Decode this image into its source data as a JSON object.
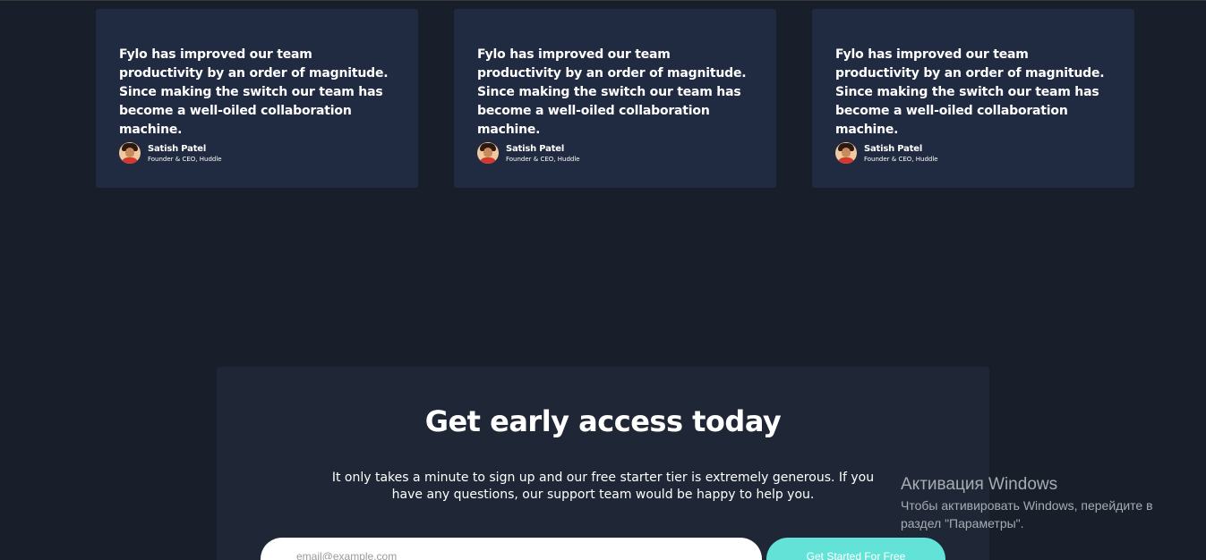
{
  "testimonials": [
    {
      "quote": "Fylo has improved our team productivity by an order of magnitude. Since making the switch our team has become a well-oiled collaboration machine.",
      "name": "Satish Patel",
      "role": "Founder & CEO, Huddle"
    },
    {
      "quote": "Fylo has improved our team productivity by an order of magnitude. Since making the switch our team has become a well-oiled collaboration machine.",
      "name": "Satish Patel",
      "role": "Founder & CEO, Huddle"
    },
    {
      "quote": "Fylo has improved our team productivity by an order of magnitude. Since making the switch our team has become a well-oiled collaboration machine.",
      "name": "Satish Patel",
      "role": "Founder & CEO, Huddle"
    }
  ],
  "access": {
    "title": "Get early access today",
    "description": "It only takes a minute to sign up and our free starter tier is extremely generous. If you have any questions, our support team would be happy to help you.",
    "email_placeholder": "email@example.com",
    "button_label": "Get Started For Free"
  },
  "windows_activation": {
    "title": "Активация Windows",
    "message": "Чтобы активировать Windows, перейдите в раздел \"Параметры\"."
  },
  "colors": {
    "background": "#181e2a",
    "card": "#202a40",
    "access_panel": "#1f2737",
    "accent": "#63e3d8"
  },
  "icons": {
    "avatar": "person-avatar"
  }
}
